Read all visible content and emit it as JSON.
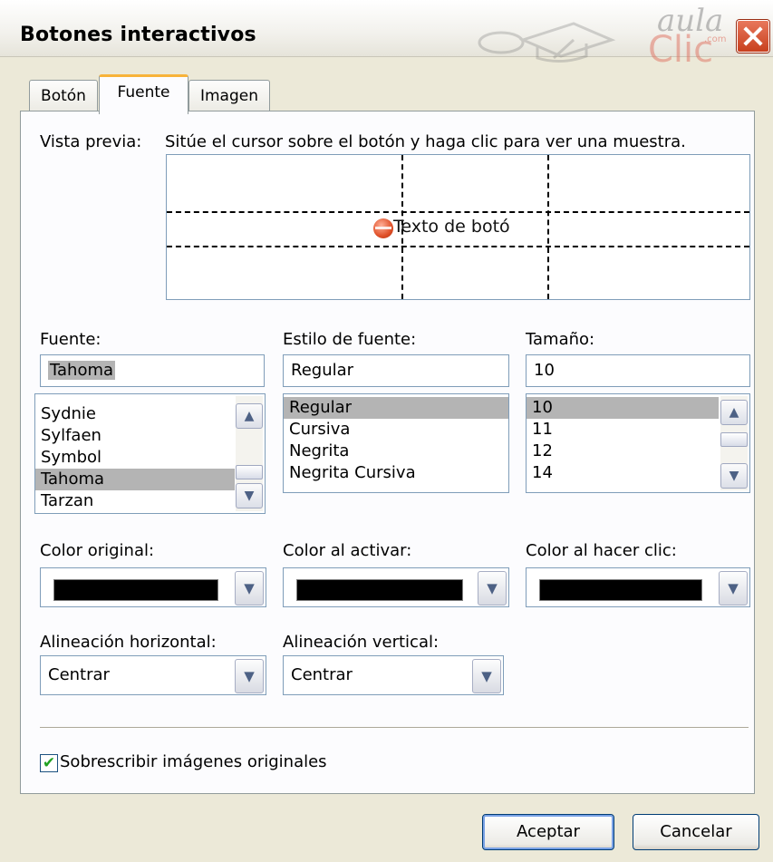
{
  "window": {
    "title": "Botones interactivos",
    "logo": {
      "line1": "aula",
      "line2": "Clic",
      "sub": ".com"
    }
  },
  "tabs": [
    {
      "label": "Botón",
      "active": false
    },
    {
      "label": "Fuente",
      "active": true
    },
    {
      "label": "Imagen",
      "active": false
    }
  ],
  "preview": {
    "label": "Vista previa:",
    "hint": "Sitúe el cursor sobre el botón y haga clic para ver una muestra.",
    "sample_text": "Texto de botó"
  },
  "font": {
    "label": "Fuente:",
    "value": "Tahoma",
    "items": [
      "Sydnie",
      "Sylfaen",
      "Symbol",
      "Tahoma",
      "Tarzan"
    ],
    "selected": "Tahoma"
  },
  "style": {
    "label": "Estilo de fuente:",
    "value": "Regular",
    "items": [
      "Regular",
      "Cursiva",
      "Negrita",
      "Negrita Cursiva"
    ],
    "selected": "Regular"
  },
  "size": {
    "label": "Tamaño:",
    "value": "10",
    "items": [
      "10",
      "11",
      "12",
      "14"
    ],
    "selected": "10"
  },
  "colors": {
    "original_label": "Color original:",
    "activate_label": "Color al activar:",
    "click_label": "Color al hacer clic:",
    "swatch_color": "#000000"
  },
  "alignment": {
    "horizontal_label": "Alineación horizontal:",
    "horizontal_value": "Centrar",
    "vertical_label": "Alineación vertical:",
    "vertical_value": "Centrar"
  },
  "overwrite": {
    "label": "Sobrescribir imágenes originales",
    "checked": true
  },
  "buttons": {
    "ok": "Aceptar",
    "cancel": "Cancelar"
  },
  "accent": {
    "tab_highlight": "#f8b33a",
    "close": "#d05030",
    "check": "#21a121"
  }
}
